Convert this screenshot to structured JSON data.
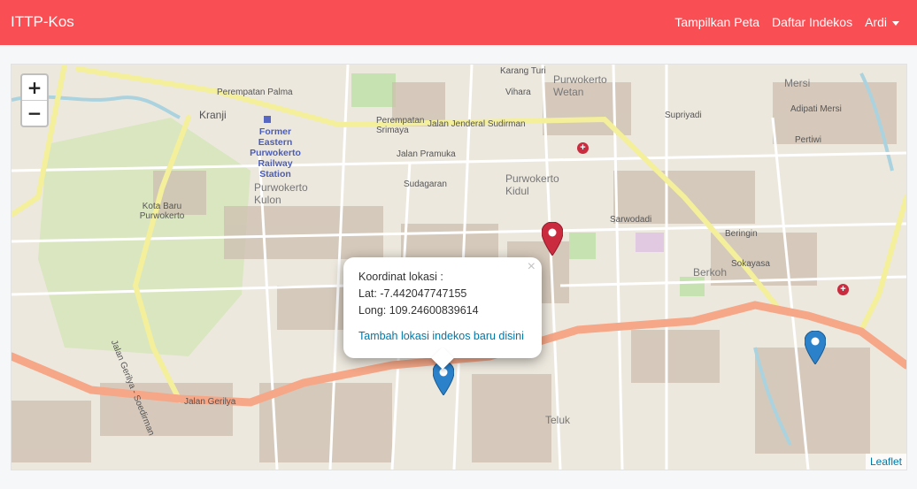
{
  "navbar": {
    "brand": "ITTP-Kos",
    "links": [
      "Tampilkan Peta",
      "Daftar Indekos"
    ],
    "user": "Ardi"
  },
  "map": {
    "zoom_in": "+",
    "zoom_out": "−",
    "attribution": "Leaflet",
    "colors": {
      "land": "#ede8de",
      "major_road": "#f5a788",
      "secondary_road": "#f7f3a8",
      "park": "#cde7b8",
      "water": "#aad3df",
      "building": "#c9b8a6",
      "marker_blue": "#2b82cb",
      "marker_red": "#cb2b3e"
    },
    "labels": [
      "Perempatan Palma",
      "Kranji",
      "Former Eastern Purwokerto Railway Station",
      "Purwokerto Kulon",
      "Kota Baru Purwokerto",
      "Perempatan Srimaya",
      "Jalan Jenderal Sudirman",
      "Jalan Pramuka",
      "Sudagaran",
      "Purwokerto Kidul",
      "Purwokerto Wetan",
      "Mersi",
      "Adipati Mersi",
      "Supriyadi",
      "Pertiwi",
      "Sarwodadi",
      "Beringin",
      "Berkoh",
      "Sokayasa",
      "Jalan Gerilya",
      "Teluk",
      "Jalan Gerilya - Soedirman",
      "Vihara",
      "Karang Turi"
    ],
    "popup": {
      "title": "Koordinat lokasi :",
      "lat_label": "Lat:",
      "lat": "-7.442047747155",
      "long_label": "Long:",
      "long": "109.24600839614",
      "link": "Tambah lokasi indekos baru disini",
      "close": "×"
    },
    "markers": [
      {
        "name": "selected-location-marker",
        "color": "blue"
      },
      {
        "name": "indekos-marker-red",
        "color": "red"
      },
      {
        "name": "indekos-marker-blue",
        "color": "blue"
      }
    ]
  }
}
